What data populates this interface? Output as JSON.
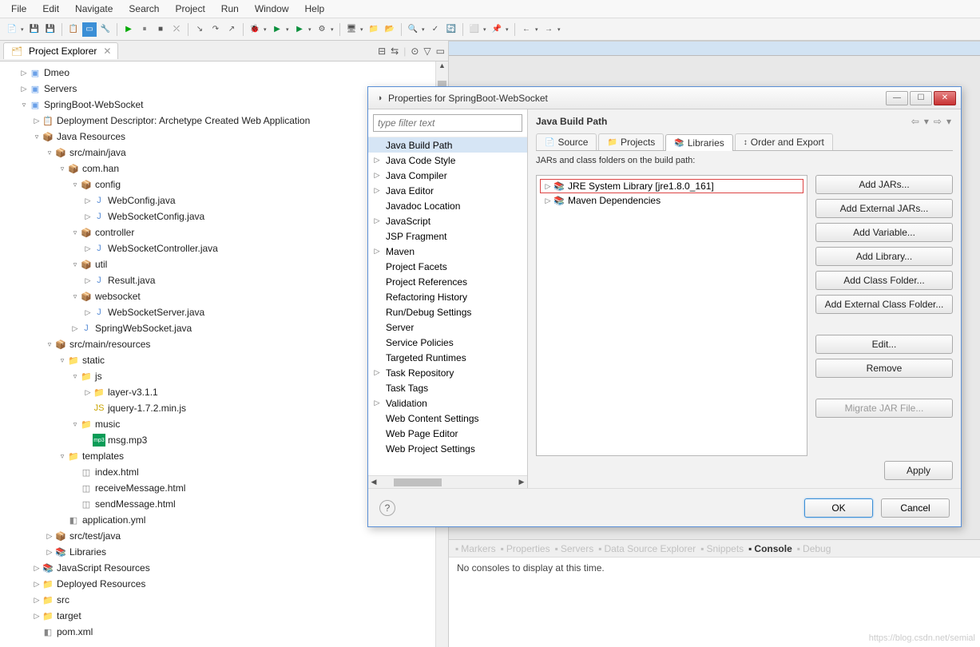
{
  "menu": [
    "File",
    "Edit",
    "Navigate",
    "Search",
    "Project",
    "Run",
    "Window",
    "Help"
  ],
  "explorer": {
    "title": "Project Explorer",
    "tree": [
      {
        "d": 1,
        "tw": "▷",
        "ic": "proj",
        "l": "Dmeo"
      },
      {
        "d": 1,
        "tw": "▷",
        "ic": "proj",
        "l": "Servers"
      },
      {
        "d": 1,
        "tw": "▿",
        "ic": "proj",
        "l": "SpringBoot-WebSocket"
      },
      {
        "d": 2,
        "tw": "▷",
        "ic": "dep",
        "l": "Deployment Descriptor: Archetype Created Web Application"
      },
      {
        "d": 2,
        "tw": "▿",
        "ic": "pkg",
        "l": "Java Resources"
      },
      {
        "d": 3,
        "tw": "▿",
        "ic": "pkg",
        "l": "src/main/java"
      },
      {
        "d": 4,
        "tw": "▿",
        "ic": "pkg",
        "l": "com.han"
      },
      {
        "d": 5,
        "tw": "▿",
        "ic": "pkg",
        "l": "config"
      },
      {
        "d": 6,
        "tw": "▷",
        "ic": "java",
        "l": "WebConfig.java"
      },
      {
        "d": 6,
        "tw": "▷",
        "ic": "java",
        "l": "WebSocketConfig.java"
      },
      {
        "d": 5,
        "tw": "▿",
        "ic": "pkg",
        "l": "controller"
      },
      {
        "d": 6,
        "tw": "▷",
        "ic": "java",
        "l": "WebSocketController.java"
      },
      {
        "d": 5,
        "tw": "▿",
        "ic": "pkg",
        "l": "util"
      },
      {
        "d": 6,
        "tw": "▷",
        "ic": "java",
        "l": "Result.java"
      },
      {
        "d": 5,
        "tw": "▿",
        "ic": "pkg",
        "l": "websocket"
      },
      {
        "d": 6,
        "tw": "▷",
        "ic": "java",
        "l": "WebSocketServer.java"
      },
      {
        "d": 5,
        "tw": "▷",
        "ic": "java",
        "l": "SpringWebSocket.java"
      },
      {
        "d": 3,
        "tw": "▿",
        "ic": "pkg",
        "l": "src/main/resources"
      },
      {
        "d": 4,
        "tw": "▿",
        "ic": "folder",
        "l": "static"
      },
      {
        "d": 5,
        "tw": "▿",
        "ic": "folder",
        "l": "js"
      },
      {
        "d": 6,
        "tw": "▷",
        "ic": "folder",
        "l": "layer-v3.1.1"
      },
      {
        "d": 6,
        "tw": "",
        "ic": "js",
        "l": "jquery-1.7.2.min.js"
      },
      {
        "d": 5,
        "tw": "▿",
        "ic": "folder",
        "l": "music"
      },
      {
        "d": 6,
        "tw": "",
        "ic": "mp3",
        "l": "msg.mp3"
      },
      {
        "d": 4,
        "tw": "▿",
        "ic": "folder",
        "l": "templates"
      },
      {
        "d": 5,
        "tw": "",
        "ic": "html",
        "l": "index.html"
      },
      {
        "d": 5,
        "tw": "",
        "ic": "html",
        "l": "receiveMessage.html"
      },
      {
        "d": 5,
        "tw": "",
        "ic": "html",
        "l": "sendMessage.html"
      },
      {
        "d": 4,
        "tw": "",
        "ic": "xml",
        "l": "application.yml"
      },
      {
        "d": 3,
        "tw": "▷",
        "ic": "pkg",
        "l": "src/test/java"
      },
      {
        "d": 3,
        "tw": "▷",
        "ic": "lib",
        "l": "Libraries"
      },
      {
        "d": 2,
        "tw": "▷",
        "ic": "lib",
        "l": "JavaScript Resources"
      },
      {
        "d": 2,
        "tw": "▷",
        "ic": "folder",
        "l": "Deployed Resources"
      },
      {
        "d": 2,
        "tw": "▷",
        "ic": "folder",
        "l": "src"
      },
      {
        "d": 2,
        "tw": "▷",
        "ic": "folder",
        "l": "target"
      },
      {
        "d": 2,
        "tw": "",
        "ic": "xml",
        "l": "pom.xml"
      }
    ]
  },
  "dialog": {
    "title": "Properties for SpringBoot-WebSocket",
    "filter_placeholder": "type filter text",
    "categories": [
      {
        "l": "Java Build Path",
        "sel": true,
        "tw": ""
      },
      {
        "l": "Java Code Style",
        "tw": "▷"
      },
      {
        "l": "Java Compiler",
        "tw": "▷"
      },
      {
        "l": "Java Editor",
        "tw": "▷"
      },
      {
        "l": "Javadoc Location",
        "tw": ""
      },
      {
        "l": "JavaScript",
        "tw": "▷"
      },
      {
        "l": "JSP Fragment",
        "tw": ""
      },
      {
        "l": "Maven",
        "tw": "▷"
      },
      {
        "l": "Project Facets",
        "tw": ""
      },
      {
        "l": "Project References",
        "tw": ""
      },
      {
        "l": "Refactoring History",
        "tw": ""
      },
      {
        "l": "Run/Debug Settings",
        "tw": ""
      },
      {
        "l": "Server",
        "tw": ""
      },
      {
        "l": "Service Policies",
        "tw": ""
      },
      {
        "l": "Targeted Runtimes",
        "tw": ""
      },
      {
        "l": "Task Repository",
        "tw": "▷"
      },
      {
        "l": "Task Tags",
        "tw": ""
      },
      {
        "l": "Validation",
        "tw": "▷"
      },
      {
        "l": "Web Content Settings",
        "tw": ""
      },
      {
        "l": "Web Page Editor",
        "tw": ""
      },
      {
        "l": "Web Project Settings",
        "tw": ""
      }
    ],
    "heading": "Java Build Path",
    "tabs": [
      {
        "ic": "📄",
        "l": "Source"
      },
      {
        "ic": "📁",
        "l": "Projects"
      },
      {
        "ic": "📚",
        "l": "Libraries"
      },
      {
        "ic": "↕",
        "l": "Order and Export"
      }
    ],
    "active_tab": 2,
    "desc": "JARs and class folders on the build path:",
    "lib_tree": [
      {
        "l": "JRE System Library [jre1.8.0_161]",
        "hl": true
      },
      {
        "l": "Maven Dependencies",
        "hl": false
      }
    ],
    "buttons": [
      "Add JARs...",
      "Add External JARs...",
      "Add Variable...",
      "Add Library...",
      "Add Class Folder...",
      "Add External Class Folder..."
    ],
    "buttons2": [
      "Edit...",
      "Remove"
    ],
    "migrate": "Migrate JAR File...",
    "apply": "Apply",
    "ok": "OK",
    "cancel": "Cancel"
  },
  "console": {
    "tabs": [
      "Markers",
      "Properties",
      "Servers",
      "Data Source Explorer",
      "Snippets",
      "Console",
      "Debug"
    ],
    "msg": "No consoles to display at this time."
  },
  "watermark": "https://blog.csdn.net/semial"
}
